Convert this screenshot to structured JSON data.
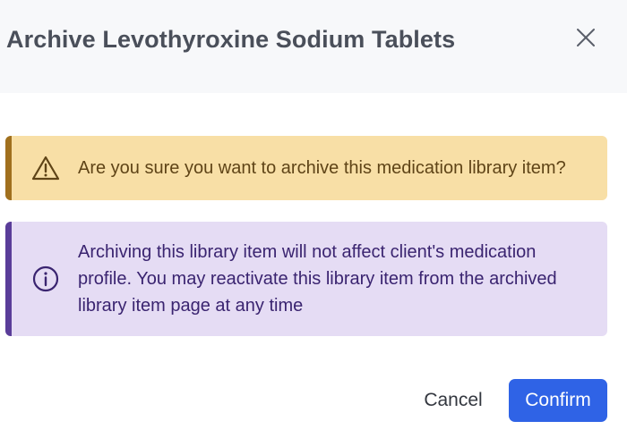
{
  "dialog": {
    "title": "Archive Levothyroxine Sodium Tablets",
    "close_icon": "close-icon"
  },
  "warning": {
    "icon": "warning-triangle-icon",
    "message": "Are you sure you want to archive this medication library item?",
    "color": "#f8dfa6",
    "accent": "#a0701e"
  },
  "info": {
    "icon": "info-circle-icon",
    "message": "Archiving this library item will not affect client's medication profile. You may reactivate this library item from the archived library item page at any time",
    "color": "#e5dcf4",
    "accent": "#5a3d99"
  },
  "footer": {
    "cancel_label": "Cancel",
    "confirm_label": "Confirm",
    "confirm_color": "#2f63e6"
  }
}
